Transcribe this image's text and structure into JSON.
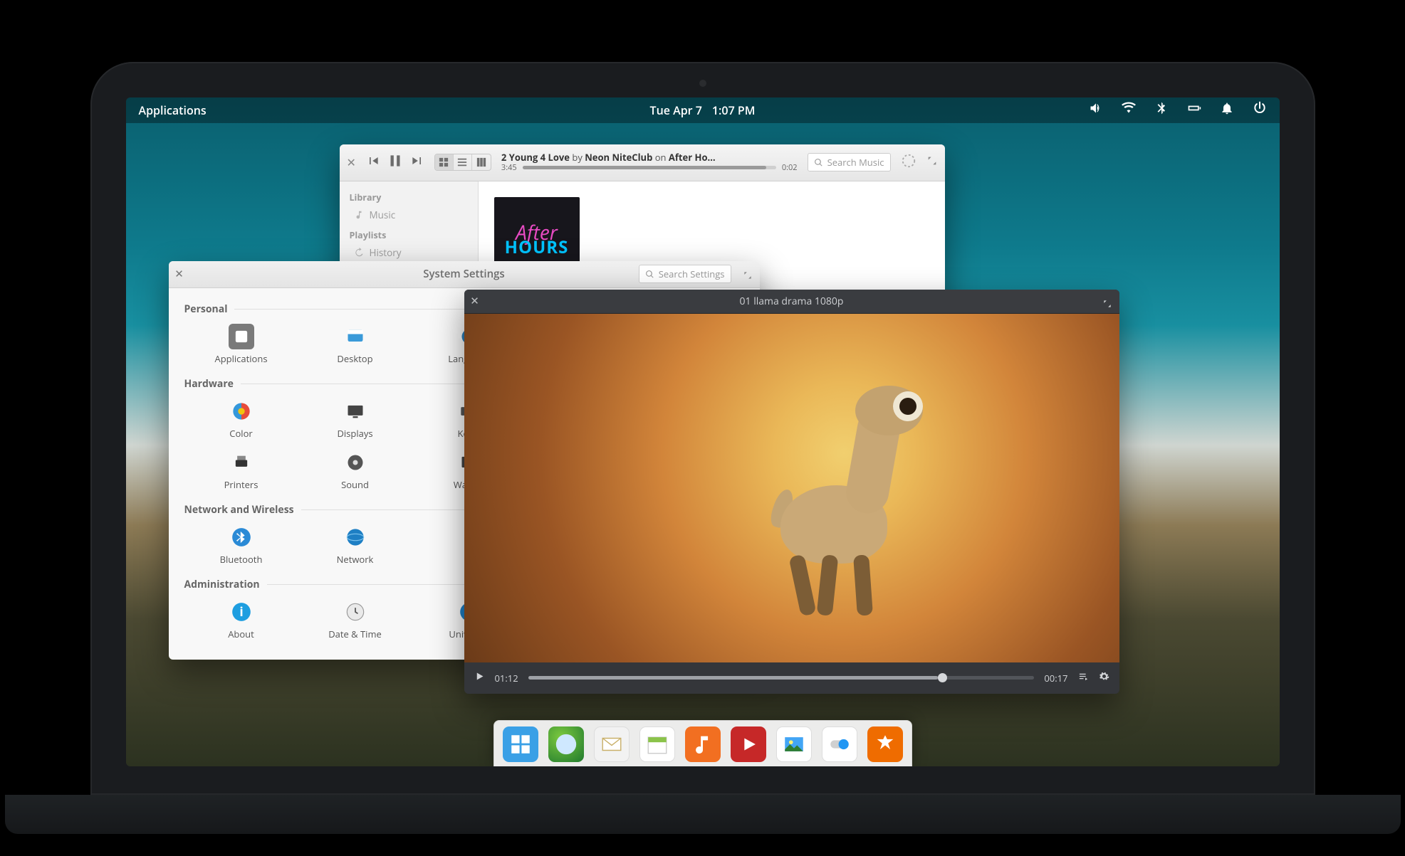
{
  "panel": {
    "apps_label": "Applications",
    "date": "Tue Apr 7",
    "time": "1:07 PM"
  },
  "music": {
    "now_playing": {
      "track": "2 Young 4 Love",
      "by_word": "by",
      "artist": "Neon NiteClub",
      "on_word": "on",
      "album": "After Ho…",
      "elapsed": "3:45",
      "remaining": "0:02"
    },
    "search_placeholder": "Search Music",
    "sidebar": {
      "library_hdr": "Library",
      "music_item": "Music",
      "playlists_hdr": "Playlists",
      "history_item": "History"
    },
    "album_line1": "After",
    "album_line2": "HOURS"
  },
  "settings": {
    "title": "System Settings",
    "search_placeholder": "Search Settings",
    "sections": {
      "personal": "Personal",
      "hardware": "Hardware",
      "network": "Network and Wireless",
      "admin": "Administration"
    },
    "items": {
      "applications": "Applications",
      "desktop": "Desktop",
      "language": "Language",
      "color": "Color",
      "displays": "Displays",
      "keyboard": "Key…",
      "printers": "Printers",
      "sound": "Sound",
      "wacom": "Waco…",
      "bluetooth": "Bluetooth",
      "network2": "Network",
      "about": "About",
      "datetime": "Date & Time",
      "universal": "Univers…"
    }
  },
  "video": {
    "title": "01 llama drama 1080p",
    "elapsed": "01:12",
    "remaining": "00:17"
  },
  "dock": {
    "items": [
      "multitask",
      "web",
      "mail",
      "calendar",
      "music",
      "videos",
      "photos",
      "switchboard",
      "appcenter"
    ]
  }
}
